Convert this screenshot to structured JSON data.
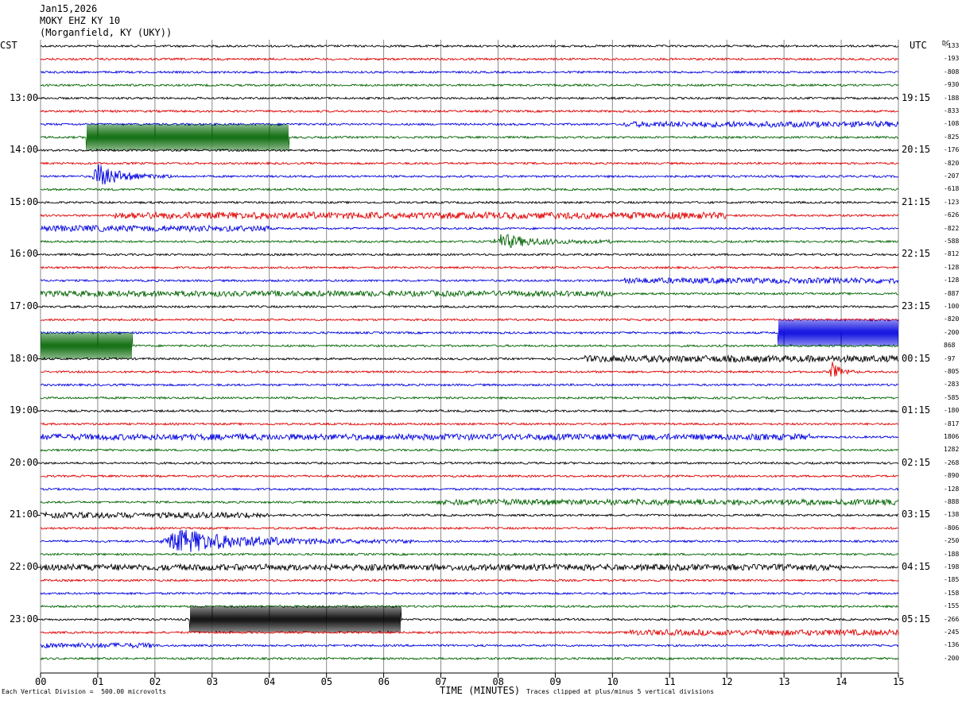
{
  "header": {
    "date": "Jan15,2026",
    "station": "MOKY EHZ KY 10",
    "location": "(Morganfield, KY (UKY))"
  },
  "left_timezone": "CST",
  "right_timezone": "UTC",
  "dc_header": "DC",
  "chart_data": {
    "type": "line",
    "description_type": "helicorder",
    "x_label": "TIME (MINUTES)",
    "x_ticks": [
      "00",
      "01",
      "02",
      "03",
      "04",
      "05",
      "06",
      "07",
      "08",
      "09",
      "10",
      "11",
      "12",
      "13",
      "14",
      "15"
    ],
    "x_range": [
      0,
      15
    ],
    "left_hour_labels": [
      "13:00",
      "14:00",
      "15:00",
      "16:00",
      "17:00",
      "18:00",
      "19:00",
      "20:00",
      "21:00",
      "22:00",
      "23:00"
    ],
    "right_hour_labels": [
      "19:15",
      "20:15",
      "21:15",
      "22:15",
      "23:15",
      "00:15",
      "01:15",
      "02:15",
      "03:15",
      "04:15",
      "05:15"
    ],
    "trace_colors": [
      "#000000",
      "#e00000",
      "#0000e0",
      "#006400"
    ],
    "trace_count": 48,
    "dc_offsets": [
      "-133",
      "-193",
      "-808",
      "-930",
      "-188",
      "-833",
      "-108",
      "-825",
      "-176",
      "-820",
      "-207",
      "-618",
      "-123",
      "-626",
      "-822",
      "-588",
      "-812",
      "-128",
      "-128",
      "-887",
      "-100",
      "-820",
      "-200",
      "868",
      "-97",
      "-805",
      "-283",
      "-585",
      "-180",
      "-817",
      "1806",
      "1282",
      "-268",
      "-890",
      "-128",
      "-888",
      "-138",
      "-806",
      "-250",
      "-188",
      "-198",
      "-185",
      "-158",
      "-155",
      "-266",
      "-245",
      "-136",
      "-200"
    ],
    "footer_left": "Each Vertical Division =  500.00 microvolts",
    "footer_right": "Traces clipped at plus/minus 5 vertical divisions",
    "events": [
      {
        "trace": 7,
        "x_start": 0.8,
        "x_end": 4.35,
        "kind": "clipped",
        "amp": 1.0
      },
      {
        "trace": 6,
        "x_start": 10.2,
        "x_end": 15.0,
        "kind": "noise",
        "amp": 0.35
      },
      {
        "trace": 10,
        "x_start": 0.9,
        "x_end": 2.3,
        "kind": "quake",
        "amp": 1.0
      },
      {
        "trace": 13,
        "x_start": 1.3,
        "x_end": 12.0,
        "kind": "noise",
        "amp": 0.45
      },
      {
        "trace": 14,
        "x_start": 0.0,
        "x_end": 4.0,
        "kind": "noise",
        "amp": 0.4
      },
      {
        "trace": 15,
        "x_start": 7.9,
        "x_end": 10.0,
        "kind": "quake",
        "amp": 0.6
      },
      {
        "trace": 18,
        "x_start": 10.2,
        "x_end": 15.0,
        "kind": "noise",
        "amp": 0.35
      },
      {
        "trace": 19,
        "x_start": 0.0,
        "x_end": 10.0,
        "kind": "noise",
        "amp": 0.35
      },
      {
        "trace": 22,
        "x_start": 12.9,
        "x_end": 15.0,
        "kind": "clipped",
        "amp": 1.0
      },
      {
        "trace": 23,
        "x_start": 0.0,
        "x_end": 1.6,
        "kind": "clipped",
        "amp": 1.0
      },
      {
        "trace": 24,
        "x_start": 9.5,
        "x_end": 15.0,
        "kind": "noise",
        "amp": 0.45
      },
      {
        "trace": 25,
        "x_start": 13.8,
        "x_end": 14.3,
        "kind": "quake",
        "amp": 0.8
      },
      {
        "trace": 30,
        "x_start": 0.0,
        "x_end": 13.5,
        "kind": "noise",
        "amp": 0.4
      },
      {
        "trace": 35,
        "x_start": 6.9,
        "x_end": 15.0,
        "kind": "noise",
        "amp": 0.35
      },
      {
        "trace": 36,
        "x_start": 0.0,
        "x_end": 4.0,
        "kind": "noise",
        "amp": 0.35
      },
      {
        "trace": 38,
        "x_start": 2.1,
        "x_end": 6.5,
        "kind": "quake",
        "amp": 1.0
      },
      {
        "trace": 40,
        "x_start": 0.0,
        "x_end": 14.0,
        "kind": "noise",
        "amp": 0.4
      },
      {
        "trace": 44,
        "x_start": 2.6,
        "x_end": 6.3,
        "kind": "clipped",
        "amp": 1.0
      },
      {
        "trace": 45,
        "x_start": 10.3,
        "x_end": 15.0,
        "kind": "noise",
        "amp": 0.35
      },
      {
        "trace": 46,
        "x_start": 0.0,
        "x_end": 2.0,
        "kind": "noise",
        "amp": 0.3
      }
    ]
  }
}
